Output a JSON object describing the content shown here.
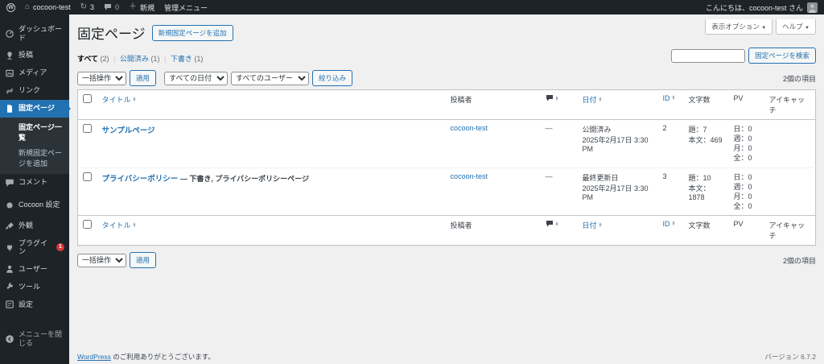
{
  "admin_bar": {
    "site_name": "cocoon-test",
    "updates_count": "3",
    "comments_count": "0",
    "new_label": "新規",
    "admin_menu_label": "管理メニュー",
    "greeting": "こんにちは、cocoon-test さん"
  },
  "icons": {
    "wp_logo": "W",
    "home": "⌂",
    "update": "↻",
    "plus": "＋",
    "chevron_down": "▼",
    "sort_up": "▲",
    "sort_down": "▼"
  },
  "sidebar": {
    "items": [
      {
        "label": "ダッシュボード"
      },
      {
        "label": "投稿"
      },
      {
        "label": "メディア"
      },
      {
        "label": "リンク"
      },
      {
        "label": "固定ページ"
      },
      {
        "label": "コメント"
      },
      {
        "label": "Cocoon 設定"
      },
      {
        "label": "外観"
      },
      {
        "label": "プラグイン",
        "badge": "1"
      },
      {
        "label": "ユーザー"
      },
      {
        "label": "ツール"
      },
      {
        "label": "設定"
      },
      {
        "label": "メニューを閉じる"
      }
    ],
    "submenu": [
      {
        "label": "固定ページ一覧"
      },
      {
        "label": "新規固定ページを追加"
      }
    ]
  },
  "header": {
    "title": "固定ページ",
    "add_new_label": "新規固定ページを追加",
    "screen_options_label": "表示オプション",
    "help_label": "ヘルプ"
  },
  "filters": {
    "all": "すべて",
    "all_count": "(2)",
    "published": "公開済み",
    "published_count": "(1)",
    "draft": "下書き",
    "draft_count": "(1)",
    "separator": "|",
    "search_button": "固定ページを検索",
    "search_value": ""
  },
  "bulk": {
    "bulk_action": "一括操作",
    "apply": "適用",
    "all_dates": "すべての日付",
    "all_users": "すべてのユーザー",
    "filter": "絞り込み",
    "items_count": "2個の項目"
  },
  "table": {
    "headers": {
      "title": "タイトル",
      "author": "投稿者",
      "date": "日付",
      "id": "ID",
      "chars": "文字数",
      "pv": "PV",
      "eyecatch": "アイキャッチ"
    },
    "rows": [
      {
        "title": "サンプルページ",
        "states": "",
        "author": "cocoon-test",
        "comments": "—",
        "date_status": "公開済み",
        "date_value": "2025年2月17日 3:30 PM",
        "id": "2",
        "chars_title": "題：7",
        "chars_body": "本文：469",
        "pv_day": "日：0",
        "pv_week": "週：0",
        "pv_month": "月：0",
        "pv_total": "全：0"
      },
      {
        "title": "プライバシーポリシー",
        "states": " — 下書き, プライバシーポリシーページ",
        "author": "cocoon-test",
        "comments": "—",
        "date_status": "最終更新日",
        "date_value": "2025年2月17日 3:30 PM",
        "id": "3",
        "chars_title": "題：10",
        "chars_body": "本文：1878",
        "pv_day": "日：0",
        "pv_week": "週：0",
        "pv_month": "月：0",
        "pv_total": "全：0"
      }
    ]
  },
  "footer": {
    "thanks_link": "WordPress",
    "thanks_rest": " のご利用ありがとうございます。",
    "version": "バージョン 6.7.2"
  },
  "colors": {
    "accent": "#2271b1",
    "admin_bar_bg": "#1d2327",
    "badge": "#d63638",
    "page_bg": "#f0f0f1"
  }
}
